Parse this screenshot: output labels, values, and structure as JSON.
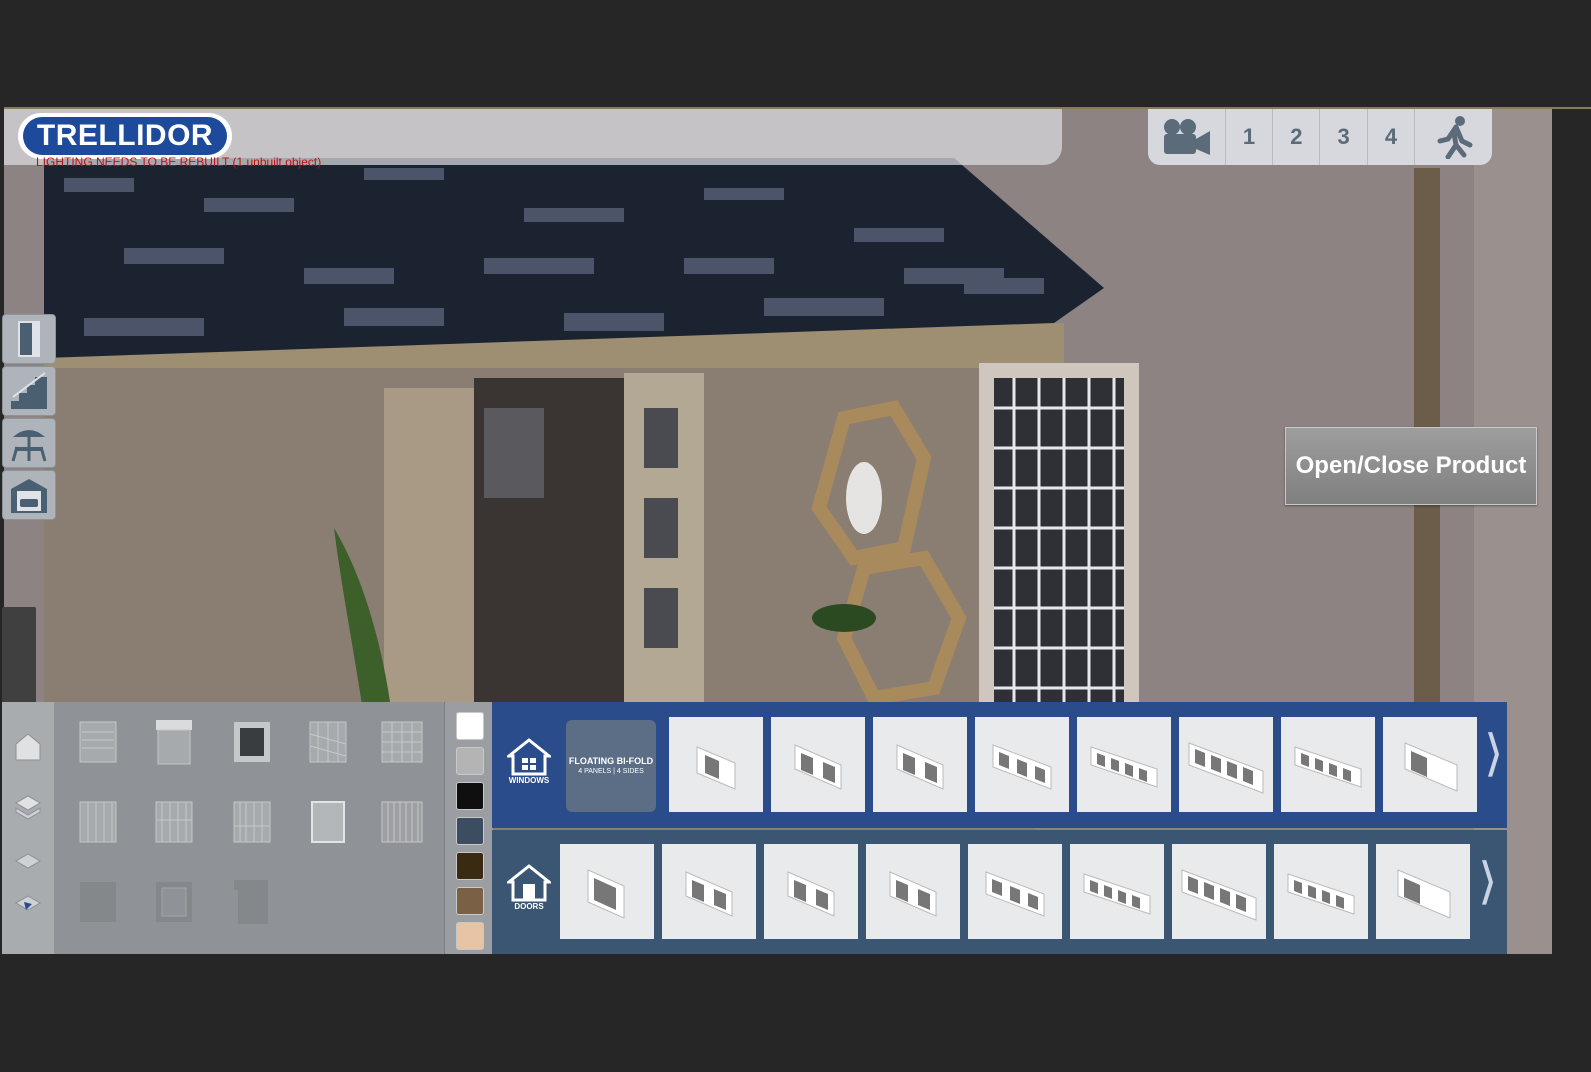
{
  "app": {
    "logo_text": "TRELLIDOR",
    "lighting_warning": "LIGHTING NEEDS TO BE REBUILT (1 unbuilt object)"
  },
  "camera_toolbar": {
    "video_icon": "video-camera-icon",
    "views": [
      "1",
      "2",
      "3",
      "4"
    ],
    "walk_icon": "walking-person-icon"
  },
  "side_menu": {
    "items": [
      {
        "name": "door-icon"
      },
      {
        "name": "staircase-icon"
      },
      {
        "name": "patio-icon"
      },
      {
        "name": "garage-icon"
      }
    ]
  },
  "scene": {
    "open_close_label": "Open/Close Product"
  },
  "bottom_panel": {
    "view_icons": [
      "house-icon",
      "layers-icon",
      "floor-icon",
      "expand-icon"
    ],
    "swatches": [
      "#ffffff",
      "#b4b4b4",
      "#0f0f0f",
      "#3c4d62",
      "#3b2a12",
      "#7a6045",
      "#e6c4a4"
    ],
    "windows": {
      "label": "WINDOWS",
      "bifold_title": "FLOATING BI-FOLD",
      "bifold_sub": "4 PANELS | 4 SIDES",
      "thumb_count_label": ""
    },
    "doors": {
      "label": "DOORS"
    }
  },
  "colors": {
    "windows_bar": "#2b4c8a",
    "doors_bar": "#3a5673",
    "logo_blue": "#1d4a9a"
  }
}
